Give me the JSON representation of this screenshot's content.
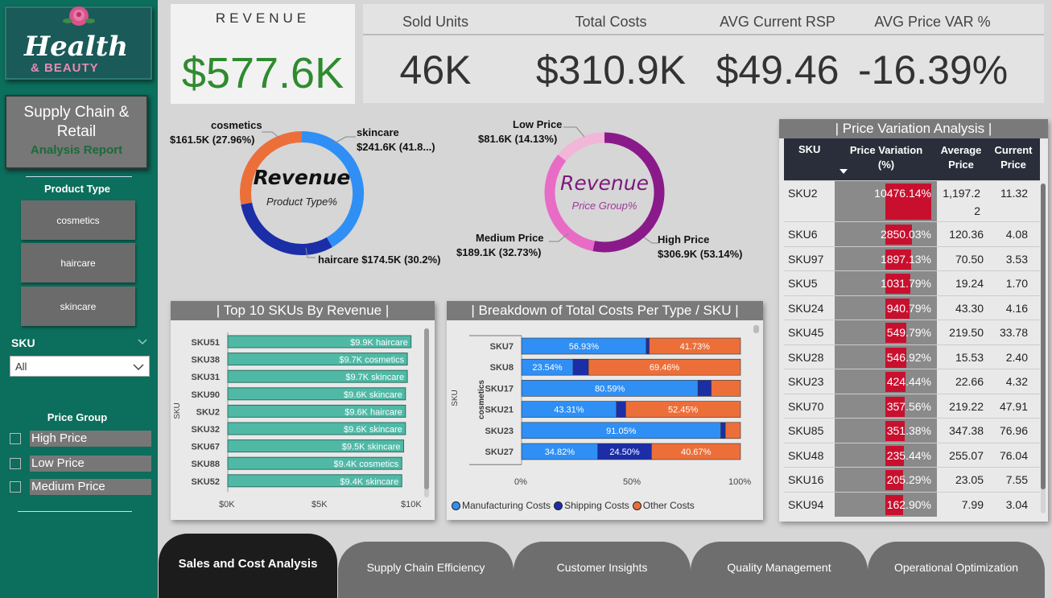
{
  "sidebar": {
    "logo_title": "Health",
    "logo_subtitle": "& BEAUTY",
    "report_title": "Supply Chain & Retail",
    "report_subtitle": "Analysis Report",
    "product_type_label": "Product Type",
    "product_types": [
      "cosmetics",
      "haircare",
      "skincare"
    ],
    "sku_label": "SKU",
    "sku_value": "All",
    "price_group_label": "Price Group",
    "price_groups": [
      "High Price",
      "Low Price",
      "Medium Price"
    ]
  },
  "kpis": {
    "revenue_label": "REVENUE",
    "revenue_value": "$577.6K",
    "items": [
      {
        "label": "Sold Units",
        "value": "46K"
      },
      {
        "label": "Total Costs",
        "value": "$310.9K"
      },
      {
        "label": "AVG Current RSP",
        "value": "$49.46"
      },
      {
        "label": "AVG Price VAR %",
        "value": "-16.39%"
      }
    ]
  },
  "donut_product": {
    "center_title": "Revenue",
    "center_subtitle": "Product Type%",
    "slices": [
      {
        "name": "skincare",
        "label": "$241.6K (41.8...)",
        "value": 41.83,
        "color": "#2f8ff5"
      },
      {
        "name": "haircare",
        "label": "haircare $174.5K (30.2%)",
        "value": 30.21,
        "color": "#1b2ea8"
      },
      {
        "name": "cosmetics",
        "label": "$161.5K (27.96%)",
        "value": 27.96,
        "color": "#ec6f3a"
      }
    ]
  },
  "donut_price": {
    "center_title": "Revenue",
    "center_subtitle": "Price Group%",
    "slices": [
      {
        "name": "High Price",
        "label": "$306.9K (53.14%)",
        "value": 53.14,
        "color": "#8a1a8a"
      },
      {
        "name": "Medium Price",
        "label": "$189.1K (32.73%)",
        "value": 32.73,
        "color": "#e86cc6"
      },
      {
        "name": "Low Price",
        "label": "$81.6K (14.13%)",
        "value": 14.13,
        "color": "#f2b6d8"
      }
    ]
  },
  "top10": {
    "title": "| Top 10 SKUs By Revenue |",
    "axis_title": "SKU",
    "ticks": [
      "$0K",
      "$5K",
      "$10K"
    ]
  },
  "costs": {
    "title": "| Breakdown of Total Costs Per Type / SKU |",
    "axis_title": "SKU",
    "group_label": "cosmetics",
    "ticks": [
      "0%",
      "50%",
      "100%"
    ],
    "legend": [
      "Manufacturing Costs",
      "Shipping Costs",
      "Other Costs"
    ],
    "colors": [
      "#2f8ff5",
      "#1b2ea8",
      "#ec6f3a"
    ]
  },
  "pv_table": {
    "title": "| Price Variation Analysis |",
    "headers": [
      "SKU",
      "Price Variation (%)",
      "Average Price",
      "Current Price"
    ],
    "rows": [
      {
        "sku": "SKU2",
        "pv": "10476.14%",
        "avg": "1,197.2 2",
        "cur": "11.32",
        "frac": 0.45
      },
      {
        "sku": "SKU6",
        "pv": "2850.03%",
        "avg": "120.36",
        "cur": "4.08",
        "frac": 0.31
      },
      {
        "sku": "SKU97",
        "pv": "1897.13%",
        "avg": "70.50",
        "cur": "3.53",
        "frac": 0.3
      },
      {
        "sku": "SKU5",
        "pv": "1031.79%",
        "avg": "19.24",
        "cur": "1.70",
        "frac": 0.29
      },
      {
        "sku": "SKU24",
        "pv": "940.79%",
        "avg": "43.30",
        "cur": "4.16",
        "frac": 0.28
      },
      {
        "sku": "SKU45",
        "pv": "549.79%",
        "avg": "219.50",
        "cur": "33.78",
        "frac": 0.24
      },
      {
        "sku": "SKU28",
        "pv": "546.92%",
        "avg": "15.53",
        "cur": "2.40",
        "frac": 0.24
      },
      {
        "sku": "SKU23",
        "pv": "424.44%",
        "avg": "22.66",
        "cur": "4.32",
        "frac": 0.23
      },
      {
        "sku": "SKU70",
        "pv": "357.56%",
        "avg": "219.22",
        "cur": "47.91",
        "frac": 0.22
      },
      {
        "sku": "SKU85",
        "pv": "351.38%",
        "avg": "347.38",
        "cur": "76.96",
        "frac": 0.22
      },
      {
        "sku": "SKU48",
        "pv": "235.44%",
        "avg": "255.07",
        "cur": "76.04",
        "frac": 0.21
      },
      {
        "sku": "SKU16",
        "pv": "205.29%",
        "avg": "23.05",
        "cur": "7.55",
        "frac": 0.2
      },
      {
        "sku": "SKU94",
        "pv": "162.90%",
        "avg": "7.99",
        "cur": "3.04",
        "frac": 0.2
      }
    ]
  },
  "tabs": [
    "Sales and Cost Analysis",
    "Supply Chain Efficiency",
    "Customer Insights",
    "Quality Management",
    "Operational Optimization"
  ],
  "chart_data": [
    {
      "type": "bar",
      "title": "| Top 10 SKUs By Revenue |",
      "ylabel": "SKU",
      "categories": [
        "SKU51",
        "SKU38",
        "SKU31",
        "SKU90",
        "SKU2",
        "SKU32",
        "SKU67",
        "SKU88",
        "SKU52"
      ],
      "values": [
        9.9,
        9.7,
        9.7,
        9.6,
        9.6,
        9.6,
        9.5,
        9.4,
        9.4
      ],
      "value_labels": [
        "$9.9K",
        "$9.7K",
        "$9.7K",
        "$9.6K",
        "$9.6K",
        "$9.6K",
        "$9.5K",
        "$9.4K",
        "$9.4K"
      ],
      "types": [
        "haircare",
        "cosmetics",
        "skincare",
        "skincare",
        "haircare",
        "skincare",
        "skincare",
        "cosmetics",
        "skincare"
      ],
      "xlim": [
        0,
        10
      ],
      "bar_color": "#4fb9a6"
    },
    {
      "type": "bar",
      "title": "| Breakdown of Total Costs Per Type / SKU |",
      "ylabel": "SKU",
      "categories": [
        "SKU7",
        "SKU8",
        "SKU17",
        "SKU21",
        "SKU23",
        "SKU27"
      ],
      "series": [
        {
          "name": "Manufacturing Costs",
          "values": [
            56.93,
            23.54,
            80.59,
            43.31,
            91.05,
            34.82
          ],
          "labels": [
            "56.93%",
            "23.54%",
            "80.59%",
            "43.31%",
            "91.05%",
            "34.82%"
          ]
        },
        {
          "name": "Shipping Costs",
          "values": [
            1.34,
            7.0,
            6.0,
            4.24,
            2.0,
            24.5
          ],
          "labels": [
            "",
            "",
            "",
            "",
            "",
            "24.50%"
          ]
        },
        {
          "name": "Other Costs",
          "values": [
            41.73,
            69.46,
            13.41,
            52.45,
            6.95,
            40.67
          ],
          "labels": [
            "41.73%",
            "69.46%",
            "",
            "52.45%",
            "",
            "40.67%"
          ]
        }
      ],
      "xlim": [
        0,
        100
      ]
    }
  ]
}
